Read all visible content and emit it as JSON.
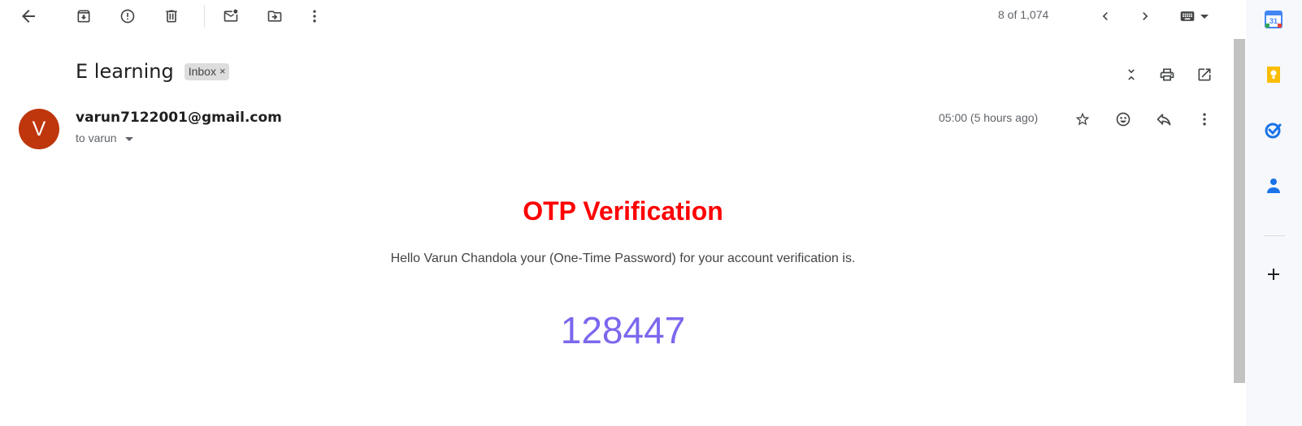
{
  "toolbar": {
    "back": "back-arrow-icon",
    "archive": "archive-icon",
    "spam": "report-spam-icon",
    "delete": "delete-icon",
    "mark_unread": "mark-unread-icon",
    "move": "move-to-icon",
    "more": "more-vert-icon"
  },
  "pagination": {
    "count": "8 of 1,074"
  },
  "email": {
    "subject": "E learning",
    "label": "Inbox",
    "label_remove": "×",
    "avatar_letter": "V",
    "avatar_color": "#bf360c",
    "sender": "varun7122001@gmail.com",
    "recipient": "to varun",
    "time": "05:00 (5 hours ago)"
  },
  "body": {
    "title": "OTP Verification",
    "message": "Hello Varun Chandola your (One-Time Password) for your account verification is.",
    "code": "128447",
    "title_color": "#ff0000",
    "code_color": "#7b68ee"
  },
  "side_panel": {
    "apps": [
      "calendar-icon",
      "keep-icon",
      "tasks-icon",
      "contacts-icon",
      "add-icon"
    ]
  }
}
